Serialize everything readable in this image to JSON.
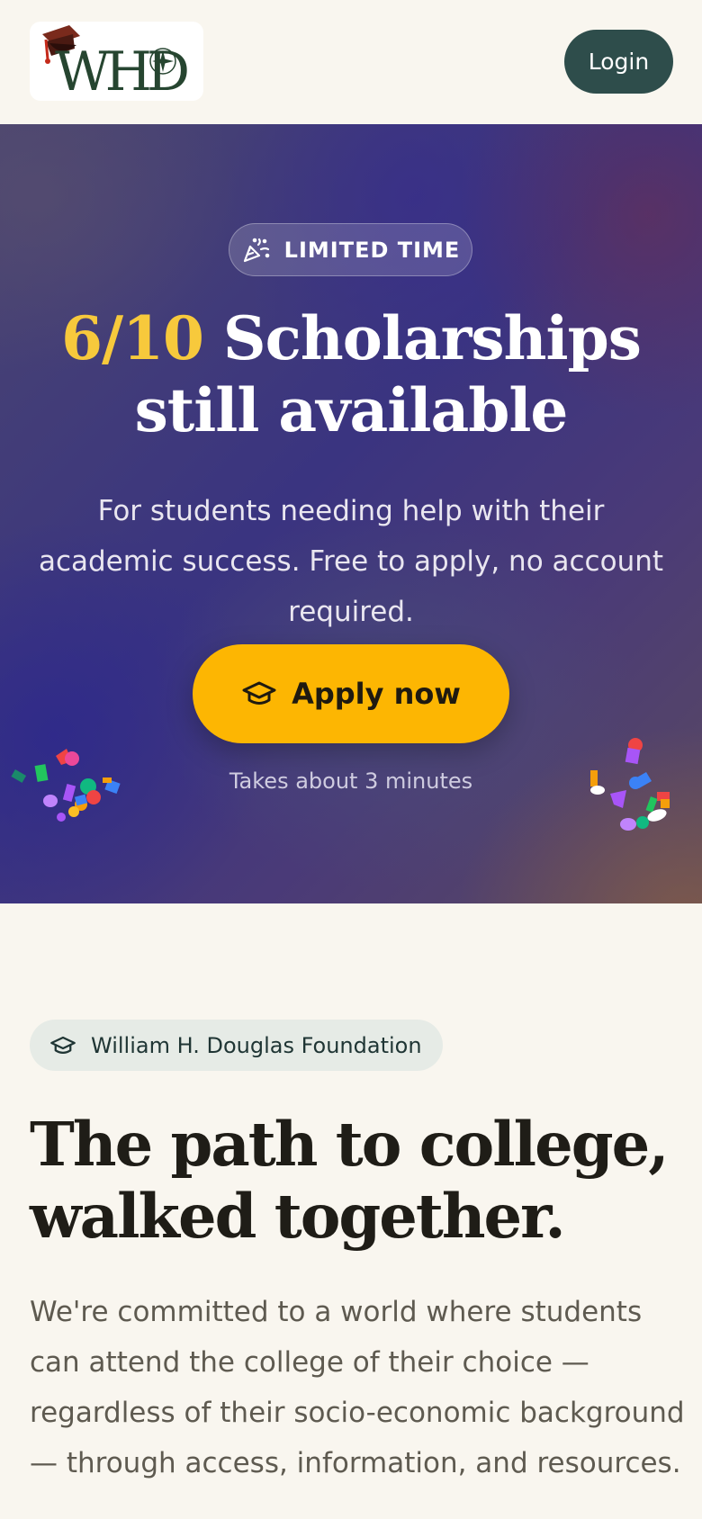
{
  "header": {
    "logo_text": "WHD",
    "login_label": "Login"
  },
  "hero": {
    "badge_icon": "party-popper-icon",
    "badge_label": "LIMITED TIME",
    "title_accent": "6/10",
    "title_line1_rest": "Scholarships",
    "title_line2": "still available",
    "subtitle": "For students needing help with their academic success. Free to apply, no account required.",
    "cta_icon": "graduation-cap-icon",
    "cta_label": "Apply now",
    "cta_note": "Takes about 3 minutes"
  },
  "intro": {
    "org_icon": "graduation-cap-icon",
    "org_label": "William H. Douglas Foundation",
    "title": "The path to college, walked together.",
    "body": "We're committed to a world where students can attend the college of their choice — regardless of their socio-economic background — through access, information, and resources."
  },
  "colors": {
    "background": "#f9f6ef",
    "login_button": "#2e4d4b",
    "accent_yellow": "#f7c93c",
    "cta_button": "#fdb602",
    "pill_background": "#e6ebe6"
  }
}
